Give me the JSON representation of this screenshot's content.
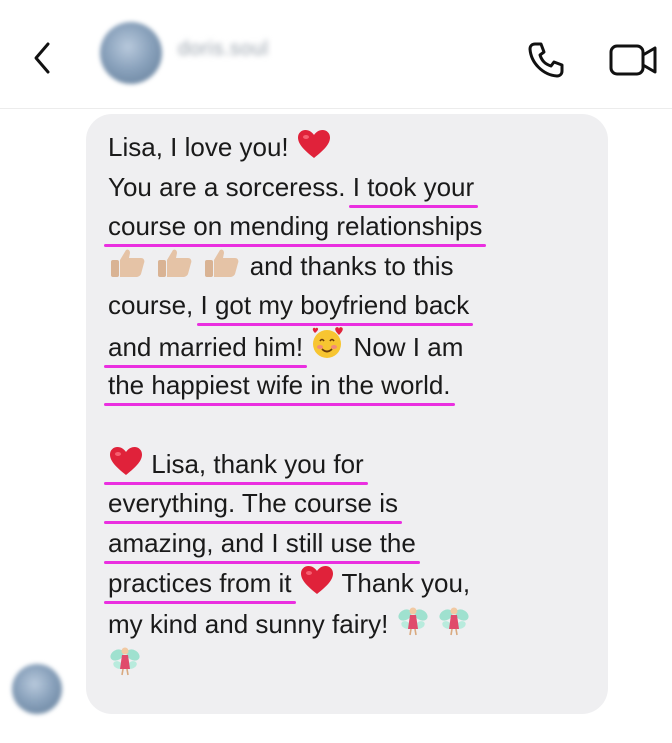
{
  "header": {
    "username": "doris.soul",
    "icons": {
      "back": "chevron-left-icon",
      "call": "phone-icon",
      "video": "video-camera-icon"
    }
  },
  "message": {
    "lines": {
      "l1": "Lisa, I love you!",
      "l2a": "You are a sorceress.",
      "l2b": "I took your",
      "l3": "course on mending relationships",
      "l4b": "and thanks to this",
      "l5a": "course,",
      "l5b": "I got my boyfriend back",
      "l6a": "and married him!",
      "l6b": "Now I am",
      "l7": "the happiest wife in the world.",
      "l8": "Lisa, thank you for",
      "l9": "everything. The course is",
      "l10": "amazing, and I still use the",
      "l11a": "practices from it",
      "l11b": "Thank you,",
      "l12": "my kind and sunny fairy!"
    },
    "emojis": [
      "heart-icon",
      "thumbs-up-icon",
      "smiling-face-with-hearts-icon",
      "fairy-icon"
    ]
  },
  "colors": {
    "bubble": "#efeff1",
    "text": "#1a1a1a",
    "highlight": "#ea2fe0",
    "heart": "#e0223a"
  }
}
